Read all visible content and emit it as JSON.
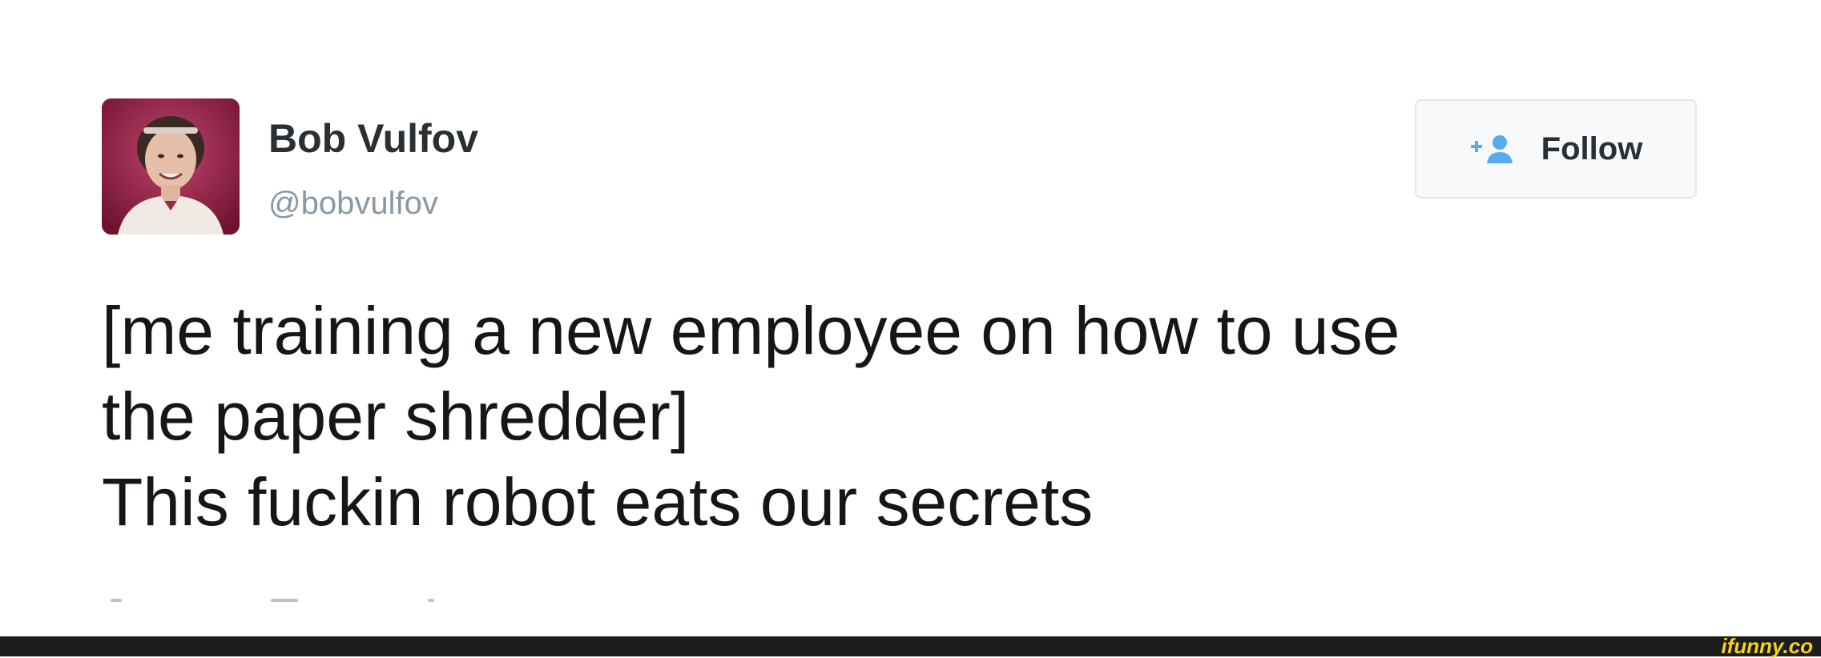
{
  "tweet": {
    "author": {
      "name": "Bob Vulfov",
      "handle": "@bobvulfov"
    },
    "follow_button": {
      "label": "Follow",
      "icon": "add-user-icon"
    },
    "text_lines": [
      "[me training a new employee on how to use",
      "the paper shredder]",
      "This fuckin robot eats our secrets"
    ]
  },
  "watermark": {
    "text": "ifunny.co"
  },
  "colors": {
    "name_text": "#292f33",
    "handle_text": "#8899a6",
    "follow_icon": "#55acee",
    "watermark": "#f3d21b",
    "footer_bar": "#1c1c1c"
  }
}
